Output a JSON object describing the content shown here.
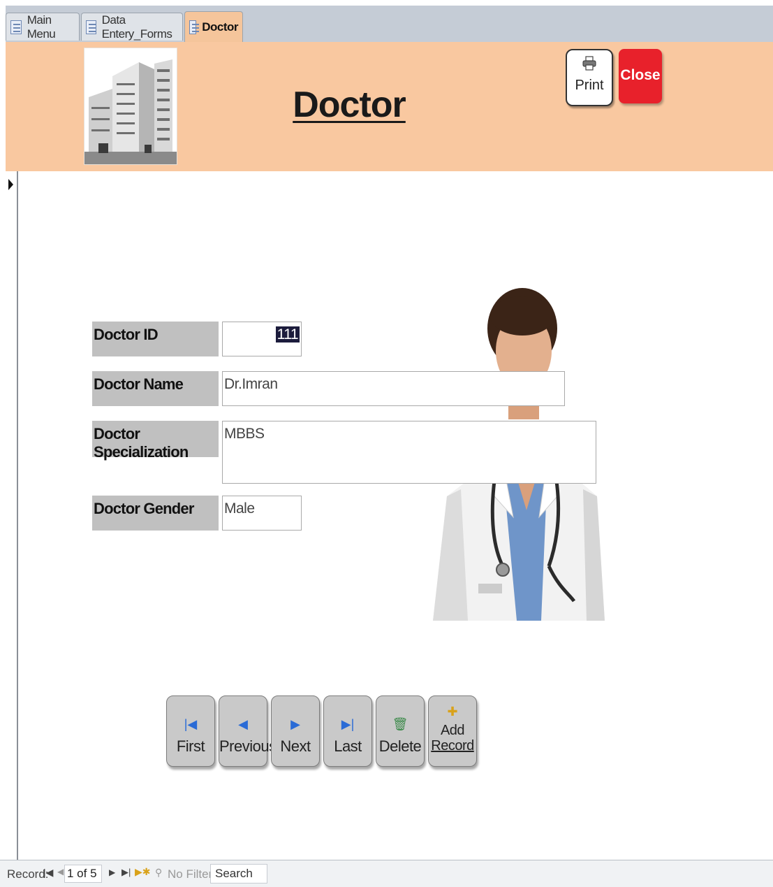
{
  "tabs": [
    {
      "label": "Main Menu",
      "active": false
    },
    {
      "label": "Data Entery_Forms",
      "active": false
    },
    {
      "label": "Doctor",
      "active": true
    }
  ],
  "header": {
    "title": "Doctor",
    "print_label": "Print",
    "close_label": "Close",
    "accent_color": "#f9c8a0",
    "close_color": "#e8212b"
  },
  "form": {
    "doctor_id": {
      "label": "Doctor ID",
      "value": "111"
    },
    "doctor_name": {
      "label": "Doctor Name",
      "value": "Dr.Imran"
    },
    "doctor_specialization": {
      "label": "Doctor Specialization",
      "value": "MBBS"
    },
    "doctor_gender": {
      "label": "Doctor Gender",
      "value": "Male"
    }
  },
  "nav_buttons": {
    "first": "First",
    "previous": "Previous",
    "next": "Next",
    "last": "Last",
    "delete": "Delete",
    "add_line1": "Add",
    "add_line2": "Record"
  },
  "record_bar": {
    "record_label": "Record:",
    "position": "1 of 5",
    "filter_label": "No Filter",
    "search_placeholder": "Search"
  },
  "icons": [
    "form-icon",
    "print-icon",
    "first-record-icon",
    "previous-record-icon",
    "next-record-icon",
    "last-record-icon",
    "delete-icon",
    "add-record-icon",
    "filter-icon"
  ]
}
